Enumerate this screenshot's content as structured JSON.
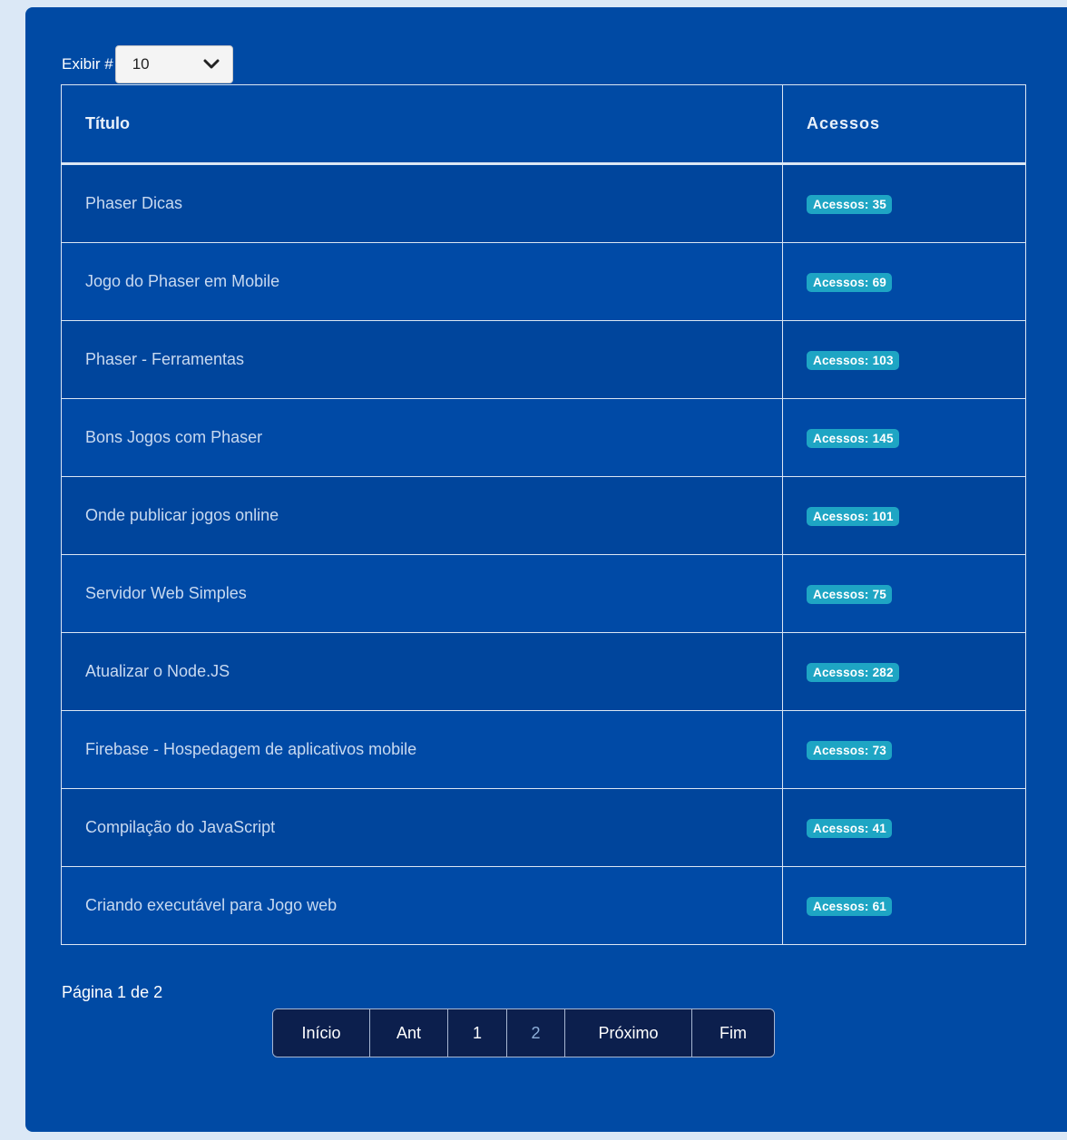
{
  "limit": {
    "label": "Exibir #",
    "value": "10"
  },
  "table": {
    "headers": {
      "title": "Título",
      "hits": "Acessos"
    },
    "rows": [
      {
        "title": "Phaser Dicas",
        "hits": "Acessos: 35"
      },
      {
        "title": "Jogo do Phaser em Mobile",
        "hits": "Acessos: 69"
      },
      {
        "title": "Phaser - Ferramentas",
        "hits": "Acessos: 103"
      },
      {
        "title": "Bons Jogos com Phaser",
        "hits": "Acessos: 145"
      },
      {
        "title": "Onde publicar jogos online",
        "hits": "Acessos: 101"
      },
      {
        "title": "Servidor Web Simples",
        "hits": "Acessos: 75"
      },
      {
        "title": "Atualizar o Node.JS",
        "hits": "Acessos: 282"
      },
      {
        "title": "Firebase - Hospedagem de aplicativos mobile",
        "hits": "Acessos: 73"
      },
      {
        "title": "Compilação do JavaScript",
        "hits": "Acessos: 41"
      },
      {
        "title": "Criando executável para Jogo web",
        "hits": "Acessos: 61"
      }
    ]
  },
  "pagination": {
    "info": "Página 1 de 2",
    "buttons": {
      "first": "Início",
      "prev": "Ant",
      "page1": "1",
      "page2": "2",
      "next": "Próximo",
      "last": "Fim"
    }
  },
  "colors": {
    "panel": "#004aa4",
    "badge": "#1ea5c4",
    "pager": "#0c1f4d"
  }
}
